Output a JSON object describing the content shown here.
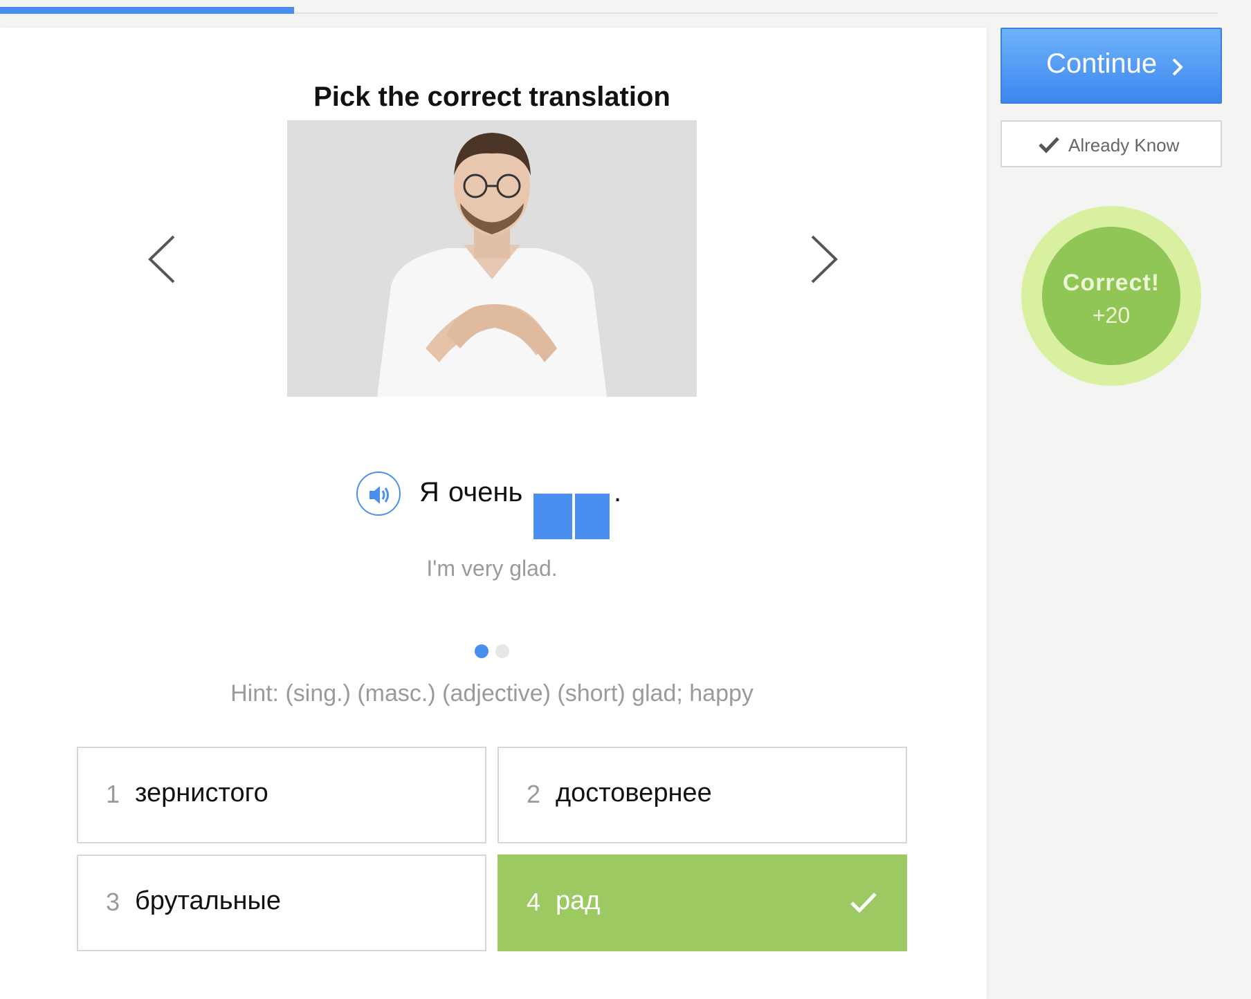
{
  "progress": {
    "fraction": 0.235
  },
  "exercise": {
    "title": "Pick the correct translation",
    "sentence": {
      "words": [
        "Я",
        "очень"
      ],
      "end": "."
    },
    "translation": "I'm very glad.",
    "hint": "Hint: (sing.) (masc.) (adjective) (short) glad; happy",
    "pager": {
      "current": 1,
      "total": 2
    },
    "choices": [
      {
        "num": "1",
        "text": "зернистого"
      },
      {
        "num": "2",
        "text": "достовернее"
      },
      {
        "num": "3",
        "text": "брутальные"
      },
      {
        "num": "4",
        "text": "рад"
      }
    ],
    "correct_choice": 4
  },
  "sidebar": {
    "continue_label": "Continue",
    "already_know_label": "Already Know",
    "result": {
      "status": "Correct!",
      "points": "+20"
    }
  },
  "icons": {
    "prev": "chevron-left-icon",
    "next": "chevron-right-icon",
    "audio": "speaker-icon",
    "check": "checkmark-icon"
  },
  "colors": {
    "accent": "#4a8ef0",
    "correct": "#9cc962",
    "badge_outer": "#d9f0a0",
    "badge_inner": "#8fc656"
  }
}
